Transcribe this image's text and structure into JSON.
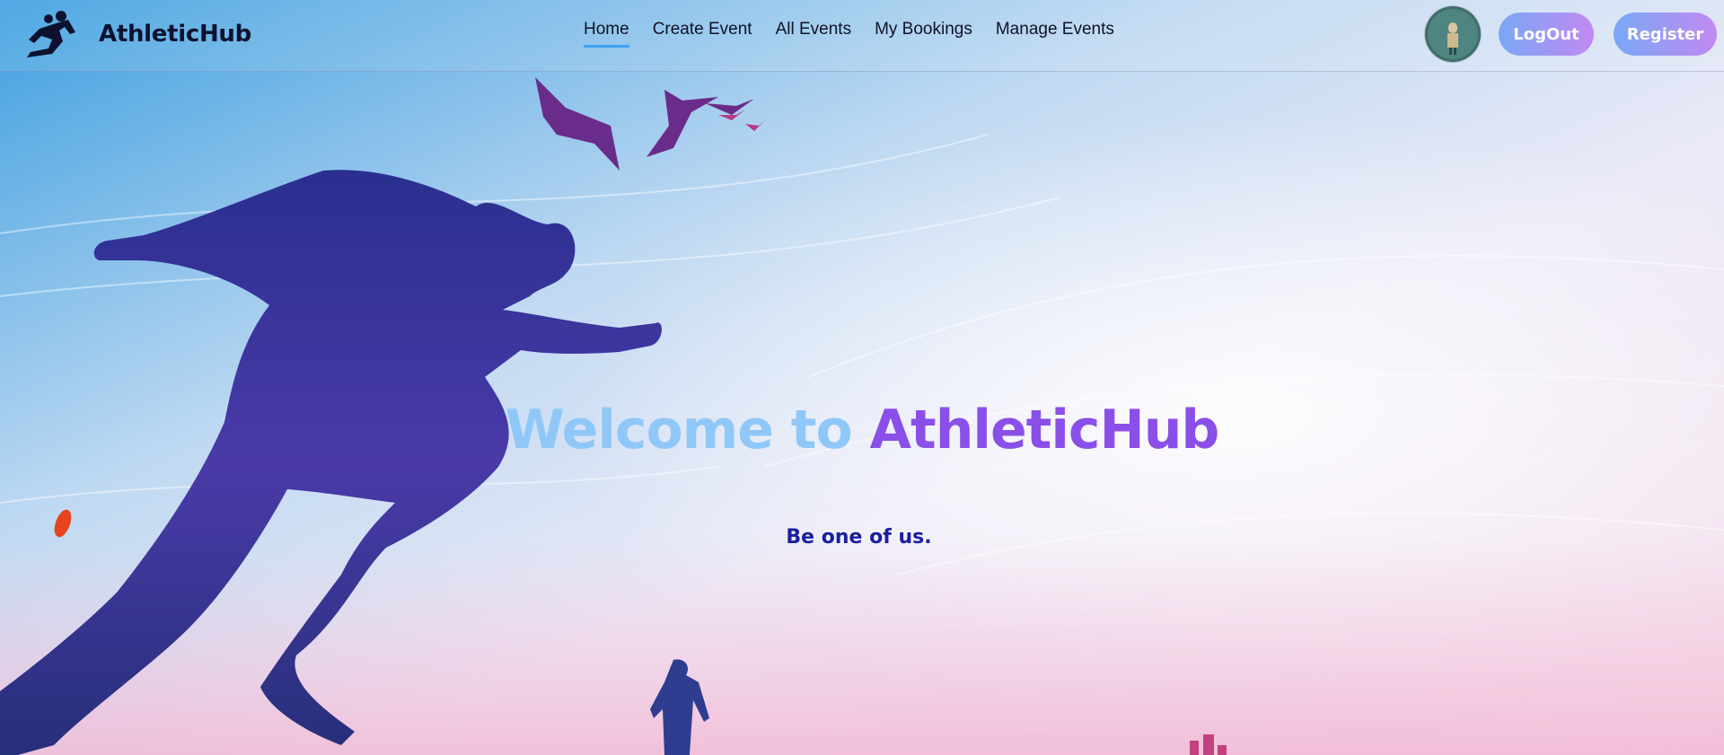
{
  "app": {
    "name": "AthleticHub",
    "logo_icon": "runner-logo-icon"
  },
  "nav": {
    "items": [
      {
        "label": "Home",
        "active": true
      },
      {
        "label": "Create Event",
        "active": false
      },
      {
        "label": "All Events",
        "active": false
      },
      {
        "label": "My Bookings",
        "active": false
      },
      {
        "label": "Manage Events",
        "active": false
      }
    ]
  },
  "user": {
    "avatar_icon": "user-avatar-icon"
  },
  "buttons": {
    "logout": "LogOut",
    "register": "Register"
  },
  "hero": {
    "title_part1": "Welcome to ",
    "title_part2": "AthleticHub",
    "subtitle": "Be one of us."
  },
  "colors": {
    "brand_dark": "#0d1230",
    "nav_active_underline": "#3ea1f0",
    "button_gradient_start": "#79a8f5",
    "button_gradient_end": "#c289f2",
    "title_light": "#8fc8f8",
    "title_accent": "#8a4fe8",
    "subtitle": "#1a1fa0"
  }
}
